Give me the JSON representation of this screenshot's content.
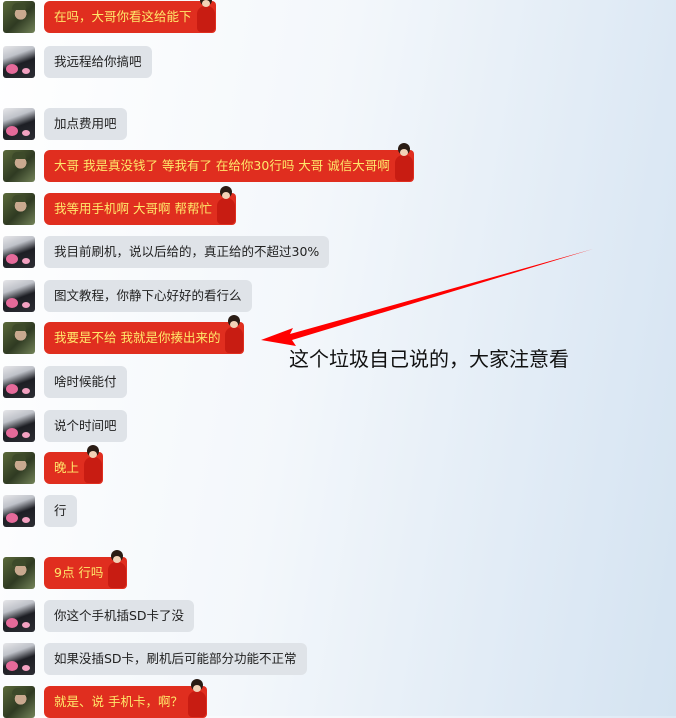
{
  "messages": [
    {
      "text": "在吗，大哥你看这给能下",
      "side": "red",
      "avatar": "soldier"
    },
    {
      "text": "我远程给你搞吧",
      "side": "gray",
      "avatar": "dark"
    },
    {
      "text": "加点费用吧",
      "side": "gray",
      "avatar": "dark"
    },
    {
      "text": "大哥 我是真没钱了  等我有了 在给你30行吗  大哥  诚信大哥啊",
      "side": "red",
      "avatar": "soldier"
    },
    {
      "text": "我等用手机啊  大哥啊  帮帮忙",
      "side": "red",
      "avatar": "soldier"
    },
    {
      "text": "我目前刷机，说以后给的，真正给的不超过30%",
      "side": "gray",
      "avatar": "dark"
    },
    {
      "text": "图文教程，你静下心好好的看行么",
      "side": "gray",
      "avatar": "dark"
    },
    {
      "text": "我要是不给  我就是你揍出来的",
      "side": "red",
      "avatar": "soldier"
    },
    {
      "text": "啥时候能付",
      "side": "gray",
      "avatar": "dark"
    },
    {
      "text": "说个时间吧",
      "side": "gray",
      "avatar": "dark"
    },
    {
      "text": "晚上",
      "side": "red",
      "avatar": "soldier"
    },
    {
      "text": "行",
      "side": "gray",
      "avatar": "dark"
    },
    {
      "text": "9点 行吗",
      "side": "red",
      "avatar": "soldier"
    },
    {
      "text": "你这个手机插SD卡了没",
      "side": "gray",
      "avatar": "dark"
    },
    {
      "text": "如果没插SD卡，刷机后可能部分功能不正常",
      "side": "gray",
      "avatar": "dark"
    },
    {
      "text": "就是、说  手机卡，啊？",
      "side": "red",
      "avatar": "soldier"
    }
  ],
  "annotation": {
    "text": "这个垃圾自己说的，大家注意看",
    "arrow_color": "#ff0000"
  }
}
